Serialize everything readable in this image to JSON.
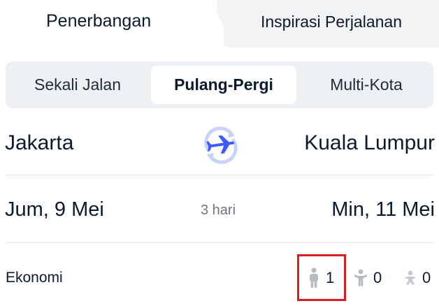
{
  "top_tabs": [
    {
      "label": "Penerbangan",
      "active": true
    },
    {
      "label": "Inspirasi Perjalanan",
      "active": false
    }
  ],
  "trip_types": [
    {
      "label": "Sekali Jalan",
      "active": false
    },
    {
      "label": "Pulang-Pergi",
      "active": true
    },
    {
      "label": "Multi-Kota",
      "active": false
    }
  ],
  "route": {
    "from_city": "Jakarta",
    "to_city": "Kuala Lumpur",
    "swap_icon": "plane-swap-icon"
  },
  "dates": {
    "departure": "Jum, 9 Mei",
    "duration": "3 hari",
    "return": "Min, 11 Mei"
  },
  "passengers": {
    "cabin_class": "Ekonomi",
    "adults": "1",
    "children": "0",
    "infants": "0"
  },
  "colors": {
    "accent_blue": "#3b5bfd",
    "highlight_red": "#d81e1e",
    "muted_text": "#6d7682"
  }
}
